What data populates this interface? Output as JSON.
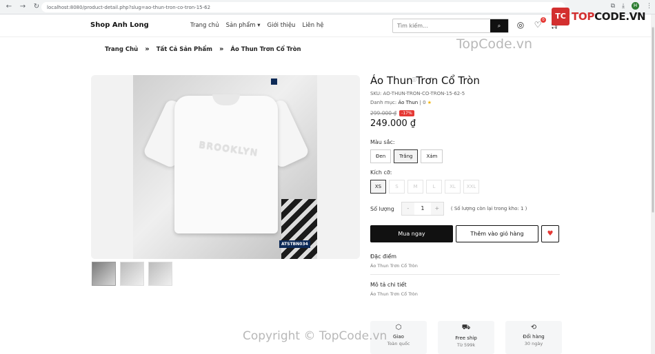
{
  "browser": {
    "url": "localhost:8080/product-detail.php?slug=ao-thun-tron-co-tron-15-62",
    "profile_initial": "H"
  },
  "header": {
    "brand": "Shop Anh Long",
    "menu": [
      "Trang chủ",
      "Sản phẩm ▾",
      "Giới thiệu",
      "Liên hệ"
    ],
    "search_placeholder": "Tìm kiếm...",
    "wishlist_count": "0",
    "cart_count": "0"
  },
  "watermark": {
    "logo_mark": "TC",
    "logo_text_a": "TOP",
    "logo_text_b": "CODE.VN",
    "site": "TopCode.vn",
    "copyright": "Copyright © TopCode.vn"
  },
  "breadcrumb": [
    "Trang Chủ",
    "Tất Cả Sản Phẩm",
    "Áo Thun Trơn Cổ Tròn"
  ],
  "breadcrumb_sep": "»",
  "product": {
    "title": "Áo Thun Trơn Cổ Tròn",
    "sku": "SKU: AO-THUN-TRON-CO-TRON-15-62-5",
    "category_label": "Danh mục:",
    "category": "Áo Thun",
    "rating": "0",
    "old_price": "299.000 ₫",
    "discount": "-17%",
    "price": "249.000 ₫",
    "image_label": "ATSTBN034",
    "print_text": "BROOKLYN"
  },
  "options": {
    "color_label": "Màu sắc:",
    "colors": [
      "Đen",
      "Trắng",
      "Xám"
    ],
    "size_label": "Kích cỡ:",
    "sizes": [
      "XS",
      "S",
      "M",
      "L",
      "XL",
      "XXL"
    ],
    "qty_label": "Số lượng",
    "qty_minus": "-",
    "qty_value": "1",
    "qty_plus": "+",
    "stock": "( Số lượng còn lại trong kho: 1 )"
  },
  "actions": {
    "buy": "Mua ngay",
    "cart": "Thêm vào giỏ hàng"
  },
  "details": {
    "features_title": "Đặc điểm",
    "features_text": "Áo Thun Trơn Cổ Tròn",
    "desc_title": "Mô tả chi tiết",
    "desc_text": "Áo Thun Trơn Cổ Tròn"
  },
  "perks": [
    {
      "title": "Giao",
      "sub": "Toàn quốc"
    },
    {
      "title": "Free ship",
      "sub": "Từ 599k"
    },
    {
      "title": "Đổi hàng",
      "sub": "30 ngày"
    }
  ]
}
